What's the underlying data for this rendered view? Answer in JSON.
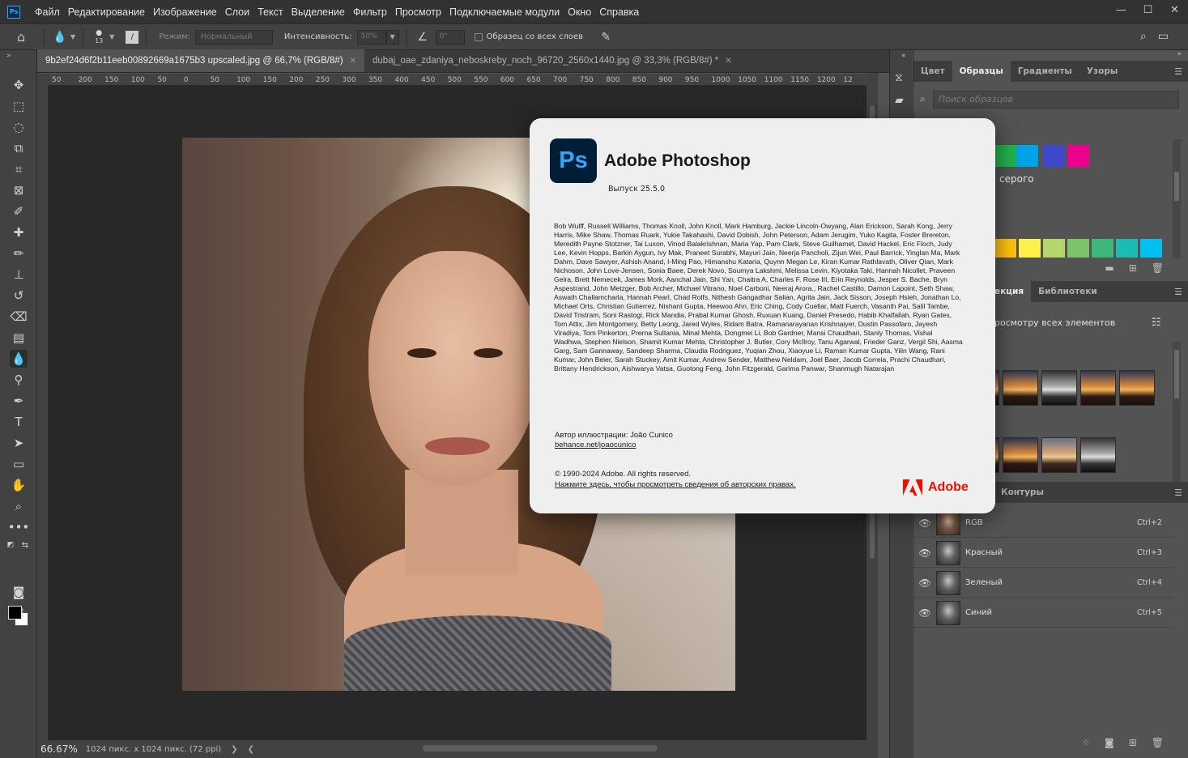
{
  "app": {
    "logo": "Ps",
    "menu": [
      "Файл",
      "Редактирование",
      "Изображение",
      "Слои",
      "Текст",
      "Выделение",
      "Фильтр",
      "Просмотр",
      "Подключаемые модули",
      "Окно",
      "Справка"
    ],
    "window_controls": [
      "—",
      "☐",
      "✕"
    ]
  },
  "options": {
    "brush_size": "13",
    "mode_label": "Режим:",
    "mode_value": "Нормальный",
    "strength_label": "Интенсивность:",
    "strength_value": "50%",
    "angle_value": "0°",
    "sample_all_label": "Образец со всех слоев"
  },
  "tabs": [
    {
      "label": "9b2ef24d6f2b11eeb00892669a1675b3 upscaled.jpg @ 66,7% (RGB/8#)",
      "active": true
    },
    {
      "label": "dubaj_oae_zdaniya_neboskreby_noch_96720_2560x1440.jpg @ 33,3% (RGB/8#) *",
      "active": false
    }
  ],
  "ruler_ticks": [
    "50",
    "200",
    "150",
    "100",
    "50",
    "0",
    "50",
    "100",
    "150",
    "200",
    "250",
    "300",
    "350",
    "400",
    "450",
    "500",
    "550",
    "600",
    "650",
    "700",
    "750",
    "800",
    "850",
    "900",
    "950",
    "1000",
    "1050",
    "1100",
    "1150",
    "1200",
    "12"
  ],
  "status": {
    "zoom": "66.67%",
    "doc_size": "1024 пикс. x 1024 пикс. (72 ppi)"
  },
  "swatches_panel": {
    "tabs": [
      "Цвет",
      "Образцы",
      "Градиенты",
      "Узоры"
    ],
    "active_tab": "Образцы",
    "search_placeholder": "Поиск образцов",
    "row1_colors": [
      "#22b14c",
      "#00a2e8",
      "#3f48cc",
      "#ec008c"
    ],
    "group_label": "серого",
    "row2_colors": [
      "#ffc20e",
      "#fff24d",
      "#b5d66b",
      "#7dc36b",
      "#3cb878",
      "#1cbbb4",
      "#00bff3"
    ]
  },
  "libraries_panel": {
    "tabs": [
      "екция",
      "Библиотеки"
    ],
    "hint": "росмотру всех элементов"
  },
  "channels_panel": {
    "tab": "Контуры",
    "rows": [
      {
        "name": "RGB",
        "shortcut": "Ctrl+2"
      },
      {
        "name": "Красный",
        "shortcut": "Ctrl+3"
      },
      {
        "name": "Зеленый",
        "shortcut": "Ctrl+4"
      },
      {
        "name": "Синий",
        "shortcut": "Ctrl+5"
      }
    ]
  },
  "about": {
    "logo": "Ps",
    "title": "Adobe Photoshop",
    "version": "Выпуск 25.5.0",
    "credits": "Bob Wulff, Russell Williams, Thomas Knoll, John Knoll, Mark Hamburg, Jackie Lincoln-Owyang, Alan Erickson, Sarah Kong, Jerry Harris, Mike Shaw, Thomas Ruark, Yukie Takahashi, David Dobish, John Peterson, Adam Jerugim, Yuko Kagita, Foster Brereton, Meredith Payne Stotzner, Tai Luxon, Vinod Balakrishnan, Maria Yap, Pam Clark, Steve Guilhamet, David Hackel, Eric Floch, Judy Lee, Kevin Hopps, Barkin Aygun, Ivy Mak, Praneet Surabhi, Mayuri Jain, Neerja Pancholi, Zijun Wei, Paul Barrick, Yinglan Ma, Mark Dahm, Dave Sawyer, Ashish Anand, I-Ming Pao, Himanshu Kataria, Quynn Megan Le, Kiran Kumar Rathlavath, Oliver Qian, Mark Nichoson, John Love-Jensen, Sonia Baee, Derek Novo, Soumya Lakshmi, Melissa Levin, Kiyotaka Taki, Hannah Nicollet, Praveen Gelra, Brett Nemecek, James Mork, Aanchal Jain, Shi Yan, Chaitra A, Charles F. Rose III, Erin Reynolds, Jesper S. Bache, Bryn Aspestrand, John Metzger, Bob Archer, Michael Vitrano, Noel Carboni, Neeraj Arora., Rachel Castillo, Damon Lapoint, Seth Shaw, Aswath Challamcharla, Hannah Pearl, Chad Rolfs, Nithesh Gangadhar Salian, Agrita Jain, Jack Sisson, Joseph Hsieh, Jonathan Lo, Michael Orts, Christian Gutierrez, Nishant Gupta, Heewoo Ahn, Eric Ching, Cody Cuellar, Matt Fuerch, Vasanth Pai, Salil Tambe, David Tristram, Soni Rastogi, Rick Mandia, Prabal Kumar Ghosh, Ruxuan Kuang, Daniel Presedo, Habib Khalfallah, Ryan Gates, Tom Attix, Jim Montgomery, Betty Leong, Jared Wyles, Ridam Batra, Ramanarayanan Krishnaiyer, Dustin Passofaro, Jayesh Viradiya, Tom Pinkerton, Prerna Sultania, Minal Mehta, Dongmei Li, Bob Gardner, Mansi Chaudhari, Stanly Thomas, Vishal Wadhwa, Stephen Nielson, Shamit Kumar Mehta, Christopher J. Butler, Cory McIlroy, Tanu Agarwal, Frieder Ganz, Vergil Shi, Aasma Garg, Sam Gannaway, Sandeep Sharma, Claudia Rodriguez, Yuqian Zhou, Xiaoyue Li, Raman Kumar Gupta, Yilin Wang, Rani Kumar, John Beier, Sarah Stuckey, Amit Kumar, Andrew Sender, Matthew Neldam, Joel Baer, Jacob Correia, Prachi Chaudhari, Brittany Hendrickson, Aishwarya Vatsa, Guotong Feng, John Fitzgerald, Garima Panwar, Shanmugh Natarajan",
    "illustration_author": "Автор иллюстрации: João Cunico",
    "illustration_link": "behance.net/joaocunico",
    "copyright": "© 1990-2024 Adobe. All rights reserved.",
    "legal_link": "Нажмите здесь, чтобы просмотреть сведения об авторских правах.",
    "brand": "Adobe",
    "brand_color": "#eb1000"
  },
  "colors": {
    "ps_accent": "#31a8ff",
    "ps_dark": "#001e36"
  }
}
